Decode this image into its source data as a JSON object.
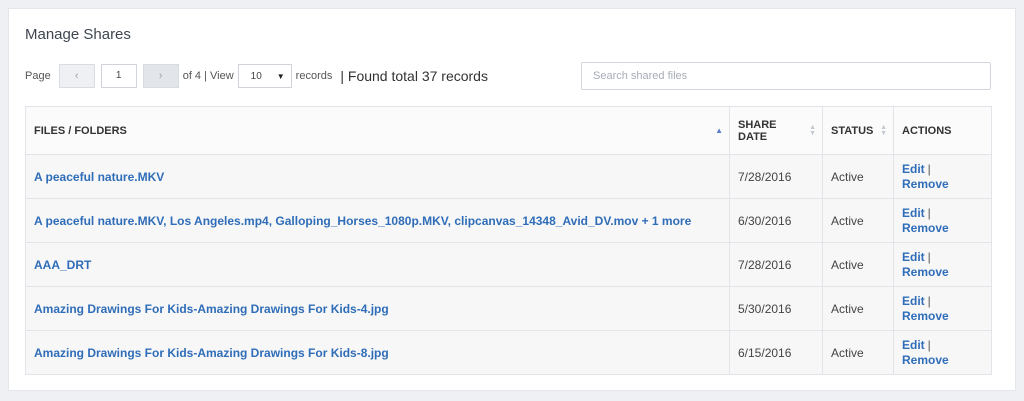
{
  "page": {
    "title": "Manage Shares"
  },
  "pager": {
    "page_label": "Page",
    "prev_icon": "‹",
    "current_page": "1",
    "next_icon": "›",
    "of_text": "of 4 | View",
    "per_page": "10",
    "records_label": "records",
    "found_text": "| Found total 37 records"
  },
  "search": {
    "placeholder": "Search shared files"
  },
  "table": {
    "headers": {
      "files": "FILES / FOLDERS",
      "share_date_line1": "SHARE",
      "share_date_line2": "DATE",
      "status": "STATUS",
      "actions": "ACTIONS"
    },
    "rows": [
      {
        "name": "A peaceful nature.MKV",
        "date": "7/28/2016",
        "status": "Active",
        "edit": "Edit",
        "sep": "|",
        "remove": "Remove"
      },
      {
        "name": "A peaceful nature.MKV, Los Angeles.mp4, Galloping_Horses_1080p.MKV, clipcanvas_14348_Avid_DV.mov + 1 more",
        "date": "6/30/2016",
        "status": "Active",
        "edit": "Edit",
        "sep": "|",
        "remove": "Remove"
      },
      {
        "name": "AAA_DRT",
        "date": "7/28/2016",
        "status": "Active",
        "edit": "Edit",
        "sep": "|",
        "remove": "Remove"
      },
      {
        "name": "Amazing Drawings For Kids-Amazing Drawings For Kids-4.jpg",
        "date": "5/30/2016",
        "status": "Active",
        "edit": "Edit",
        "sep": "|",
        "remove": "Remove"
      },
      {
        "name": "Amazing Drawings For Kids-Amazing Drawings For Kids-8.jpg",
        "date": "6/15/2016",
        "status": "Active",
        "edit": "Edit",
        "sep": "|",
        "remove": "Remove"
      }
    ]
  },
  "colors": {
    "link": "#2f6db8",
    "background": "#eef0f4"
  }
}
